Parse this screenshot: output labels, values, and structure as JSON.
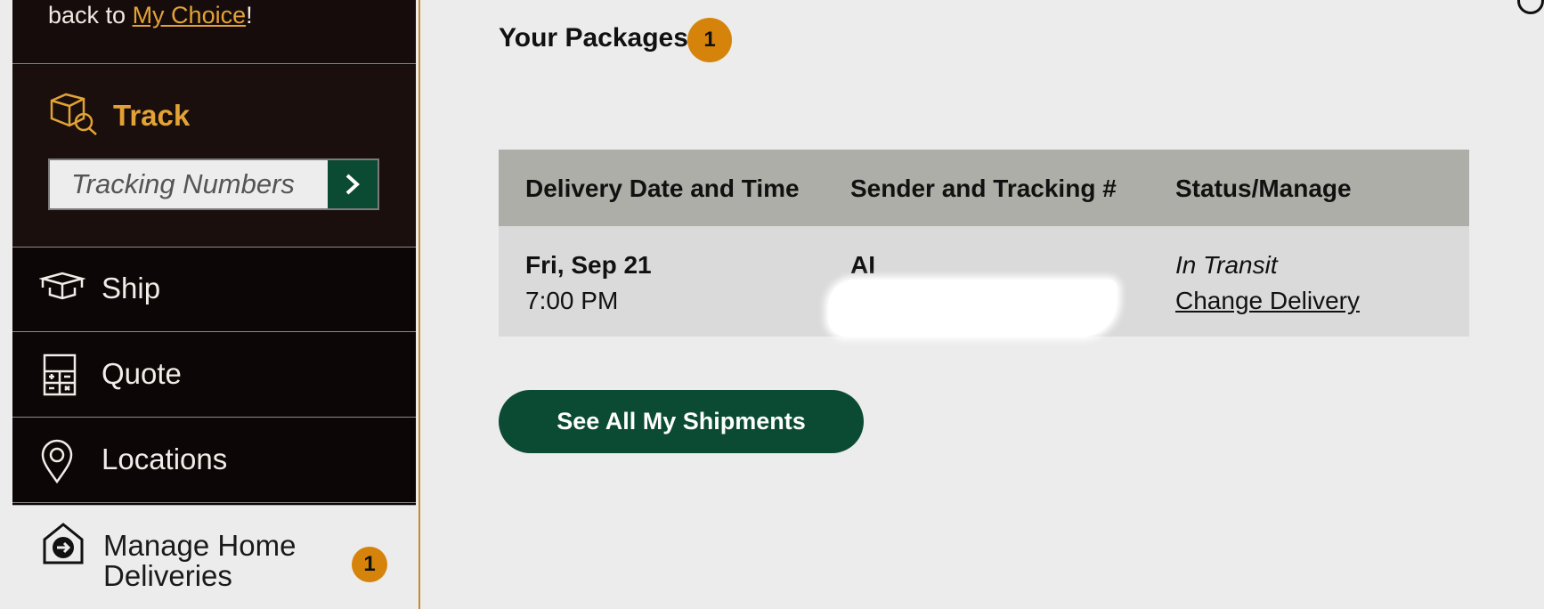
{
  "sidebar": {
    "welcome_prefix": "back to ",
    "welcome_link": "My Choice",
    "welcome_suffix": "!",
    "track": {
      "title": "Track",
      "input_placeholder": "Tracking Numbers",
      "go_icon": "chevron-right-icon"
    },
    "items": [
      {
        "label": "Ship",
        "icon": "box-icon"
      },
      {
        "label": "Quote",
        "icon": "calculator-icon"
      },
      {
        "label": "Locations",
        "icon": "location-pin-icon"
      }
    ],
    "manage": {
      "label": "Manage Home Deliveries",
      "badge": "1",
      "icon": "home-delivery-icon"
    }
  },
  "main": {
    "packages_title": "Your Packages",
    "packages_count": "1",
    "table": {
      "headers": [
        "Delivery Date and Time",
        "Sender and Tracking #",
        "Status/Manage"
      ],
      "rows": [
        {
          "date": "Fri, Sep 21",
          "time": "7:00 PM",
          "sender": "AI",
          "status": "In Transit",
          "action": "Change Delivery"
        }
      ]
    },
    "see_all_button": "See All My Shipments"
  },
  "colors": {
    "accent_gold": "#e2a235",
    "badge_orange": "#d5830a",
    "brand_green": "#0b4a33",
    "sidebar_bg": "#0c0606",
    "table_header_bg": "#adaea8"
  }
}
